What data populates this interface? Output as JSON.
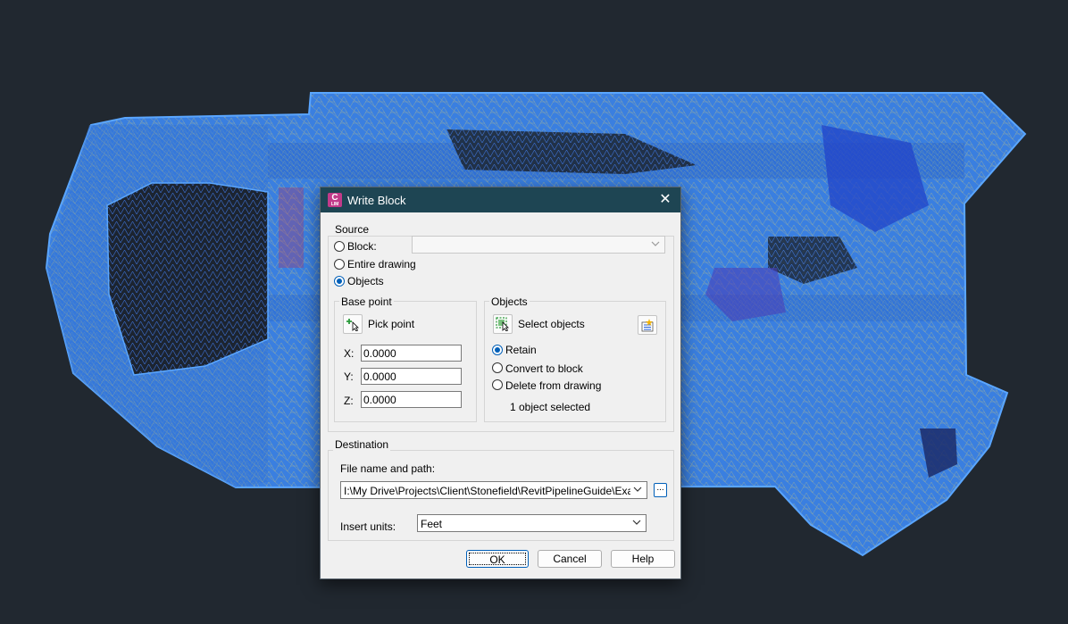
{
  "dialog": {
    "title": "Write Block",
    "app_icon_letter": "C",
    "app_icon_sub": "LIM",
    "close_glyph": "✕",
    "source": {
      "group_label": "Source",
      "block_label": "Block:",
      "block_value": "",
      "entire_drawing_label": "Entire drawing",
      "objects_label": "Objects",
      "selected": "objects"
    },
    "base_point": {
      "group_label": "Base point",
      "pick_point_label": "Pick point",
      "x_label": "X:",
      "y_label": "Y:",
      "z_label": "Z:",
      "x_value": "0.0000",
      "y_value": "0.0000",
      "z_value": "0.0000"
    },
    "objects": {
      "group_label": "Objects",
      "select_objects_label": "Select objects",
      "retain_label": "Retain",
      "convert_label": "Convert to block",
      "delete_label": "Delete from drawing",
      "status": "1 object selected",
      "selected": "retain"
    },
    "destination": {
      "group_label": "Destination",
      "file_label": "File name and path:",
      "file_value": "I:\\My Drive\\Projects\\Client\\Stonefield\\RevitPipelineGuide\\ExampleFiles\\Block.dwg",
      "browse_label": "...",
      "units_label": "Insert units:",
      "units_value": "Feet"
    },
    "buttons": {
      "ok": "OK",
      "cancel": "Cancel",
      "help": "Help"
    }
  },
  "colors": {
    "canvas_background": "#212830",
    "mesh_fill": "#3a7fe0",
    "mesh_edge": "#5aa6ff",
    "mesh_lines": "#c8c47a",
    "titlebar": "#1e4553",
    "accent": "#005fb8"
  }
}
